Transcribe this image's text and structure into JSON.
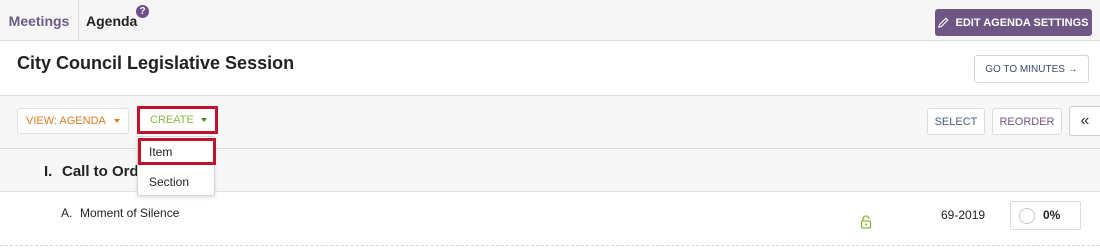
{
  "nav": {
    "meetings_label": "Meetings",
    "agenda_label": "Agenda",
    "help_glyph": "?",
    "edit_settings_label": "EDIT AGENDA SETTINGS"
  },
  "page": {
    "title": "City Council Legislative Session",
    "go_to_minutes_label": "GO TO MINUTES →"
  },
  "toolbar": {
    "view_label": "VIEW: AGENDA",
    "create_label": "CREATE",
    "select_label": "SELECT",
    "reorder_label": "REORDER",
    "collapse_glyph": "«"
  },
  "create_menu": {
    "items": [
      {
        "label": "Item"
      },
      {
        "label": "Section"
      }
    ]
  },
  "agenda": {
    "section": {
      "number": "I.",
      "title": "Call to Ord"
    },
    "items": [
      {
        "letter": "A.",
        "title": "Moment of Silence",
        "number": "69-2019",
        "progress": "0%"
      }
    ]
  },
  "icons": {
    "edit": "pencil-icon",
    "lock": "lock-icon",
    "help": "help-icon",
    "progress": "progress-circle-icon"
  },
  "colors": {
    "brand_purple": "#6f5785",
    "view_orange": "#e07a1f",
    "create_green": "#86b83f",
    "highlight_red": "#c3102f",
    "lock_green": "#86b83f"
  }
}
